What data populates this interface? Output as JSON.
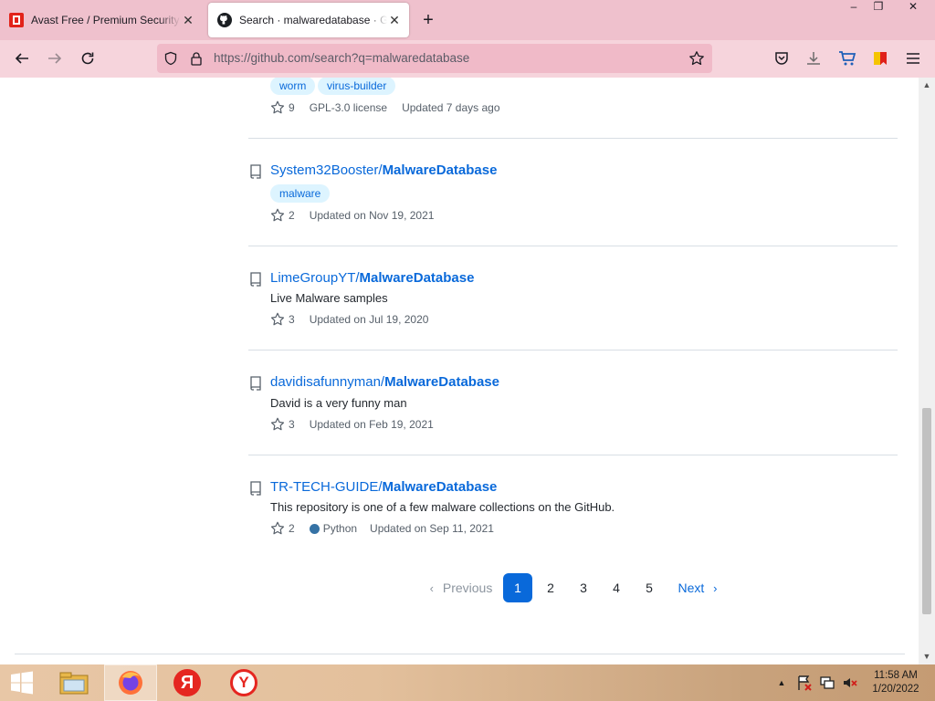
{
  "browser": {
    "tabs": [
      {
        "title": "Avast Free / Premium Security | Download"
      },
      {
        "title": "Search · malwaredatabase · GitHub"
      }
    ],
    "new_tab": "+",
    "window_controls": {
      "minimize": "–",
      "restore": "❐",
      "close": "✕"
    },
    "url": "https://github.com/search?q=malwaredatabase"
  },
  "results": [
    {
      "topics": [
        "worm",
        "virus-builder"
      ],
      "stars": "9",
      "license": "GPL-3.0 license",
      "updated": "Updated 7 days ago"
    },
    {
      "owner": "System32Booster/",
      "name": "MalwareDatabase",
      "topics": [
        "malware"
      ],
      "stars": "2",
      "updated": "Updated on Nov 19, 2021"
    },
    {
      "owner": "LimeGroupYT/",
      "name": "MalwareDatabase",
      "description": "Live Malware samples",
      "stars": "3",
      "updated": "Updated on Jul 19, 2020"
    },
    {
      "owner": "davidisafunnyman/",
      "name": "MalwareDatabase",
      "description": "David is a very funny man",
      "stars": "3",
      "updated": "Updated on Feb 19, 2021"
    },
    {
      "owner": "TR-TECH-GUIDE/",
      "name": "MalwareDatabase",
      "description": "This repository is one of a few malware collections on the GitHub.",
      "stars": "2",
      "language": "Python",
      "language_color": "#3572A5",
      "updated": "Updated on Sep 11, 2021"
    }
  ],
  "pagination": {
    "previous": "Previous",
    "pages": [
      "1",
      "2",
      "3",
      "4",
      "5"
    ],
    "current": "1",
    "next": "Next"
  },
  "taskbar": {
    "time": "11:58 AM",
    "date": "1/20/2022",
    "yandex_browser_letter": "Я",
    "yandex_app_letter": "Y"
  },
  "colors": {
    "link": "#0969da",
    "tabstrip": "#efc1cd",
    "navbar": "#f6d4dc",
    "urlbar": "#f0bac8"
  }
}
